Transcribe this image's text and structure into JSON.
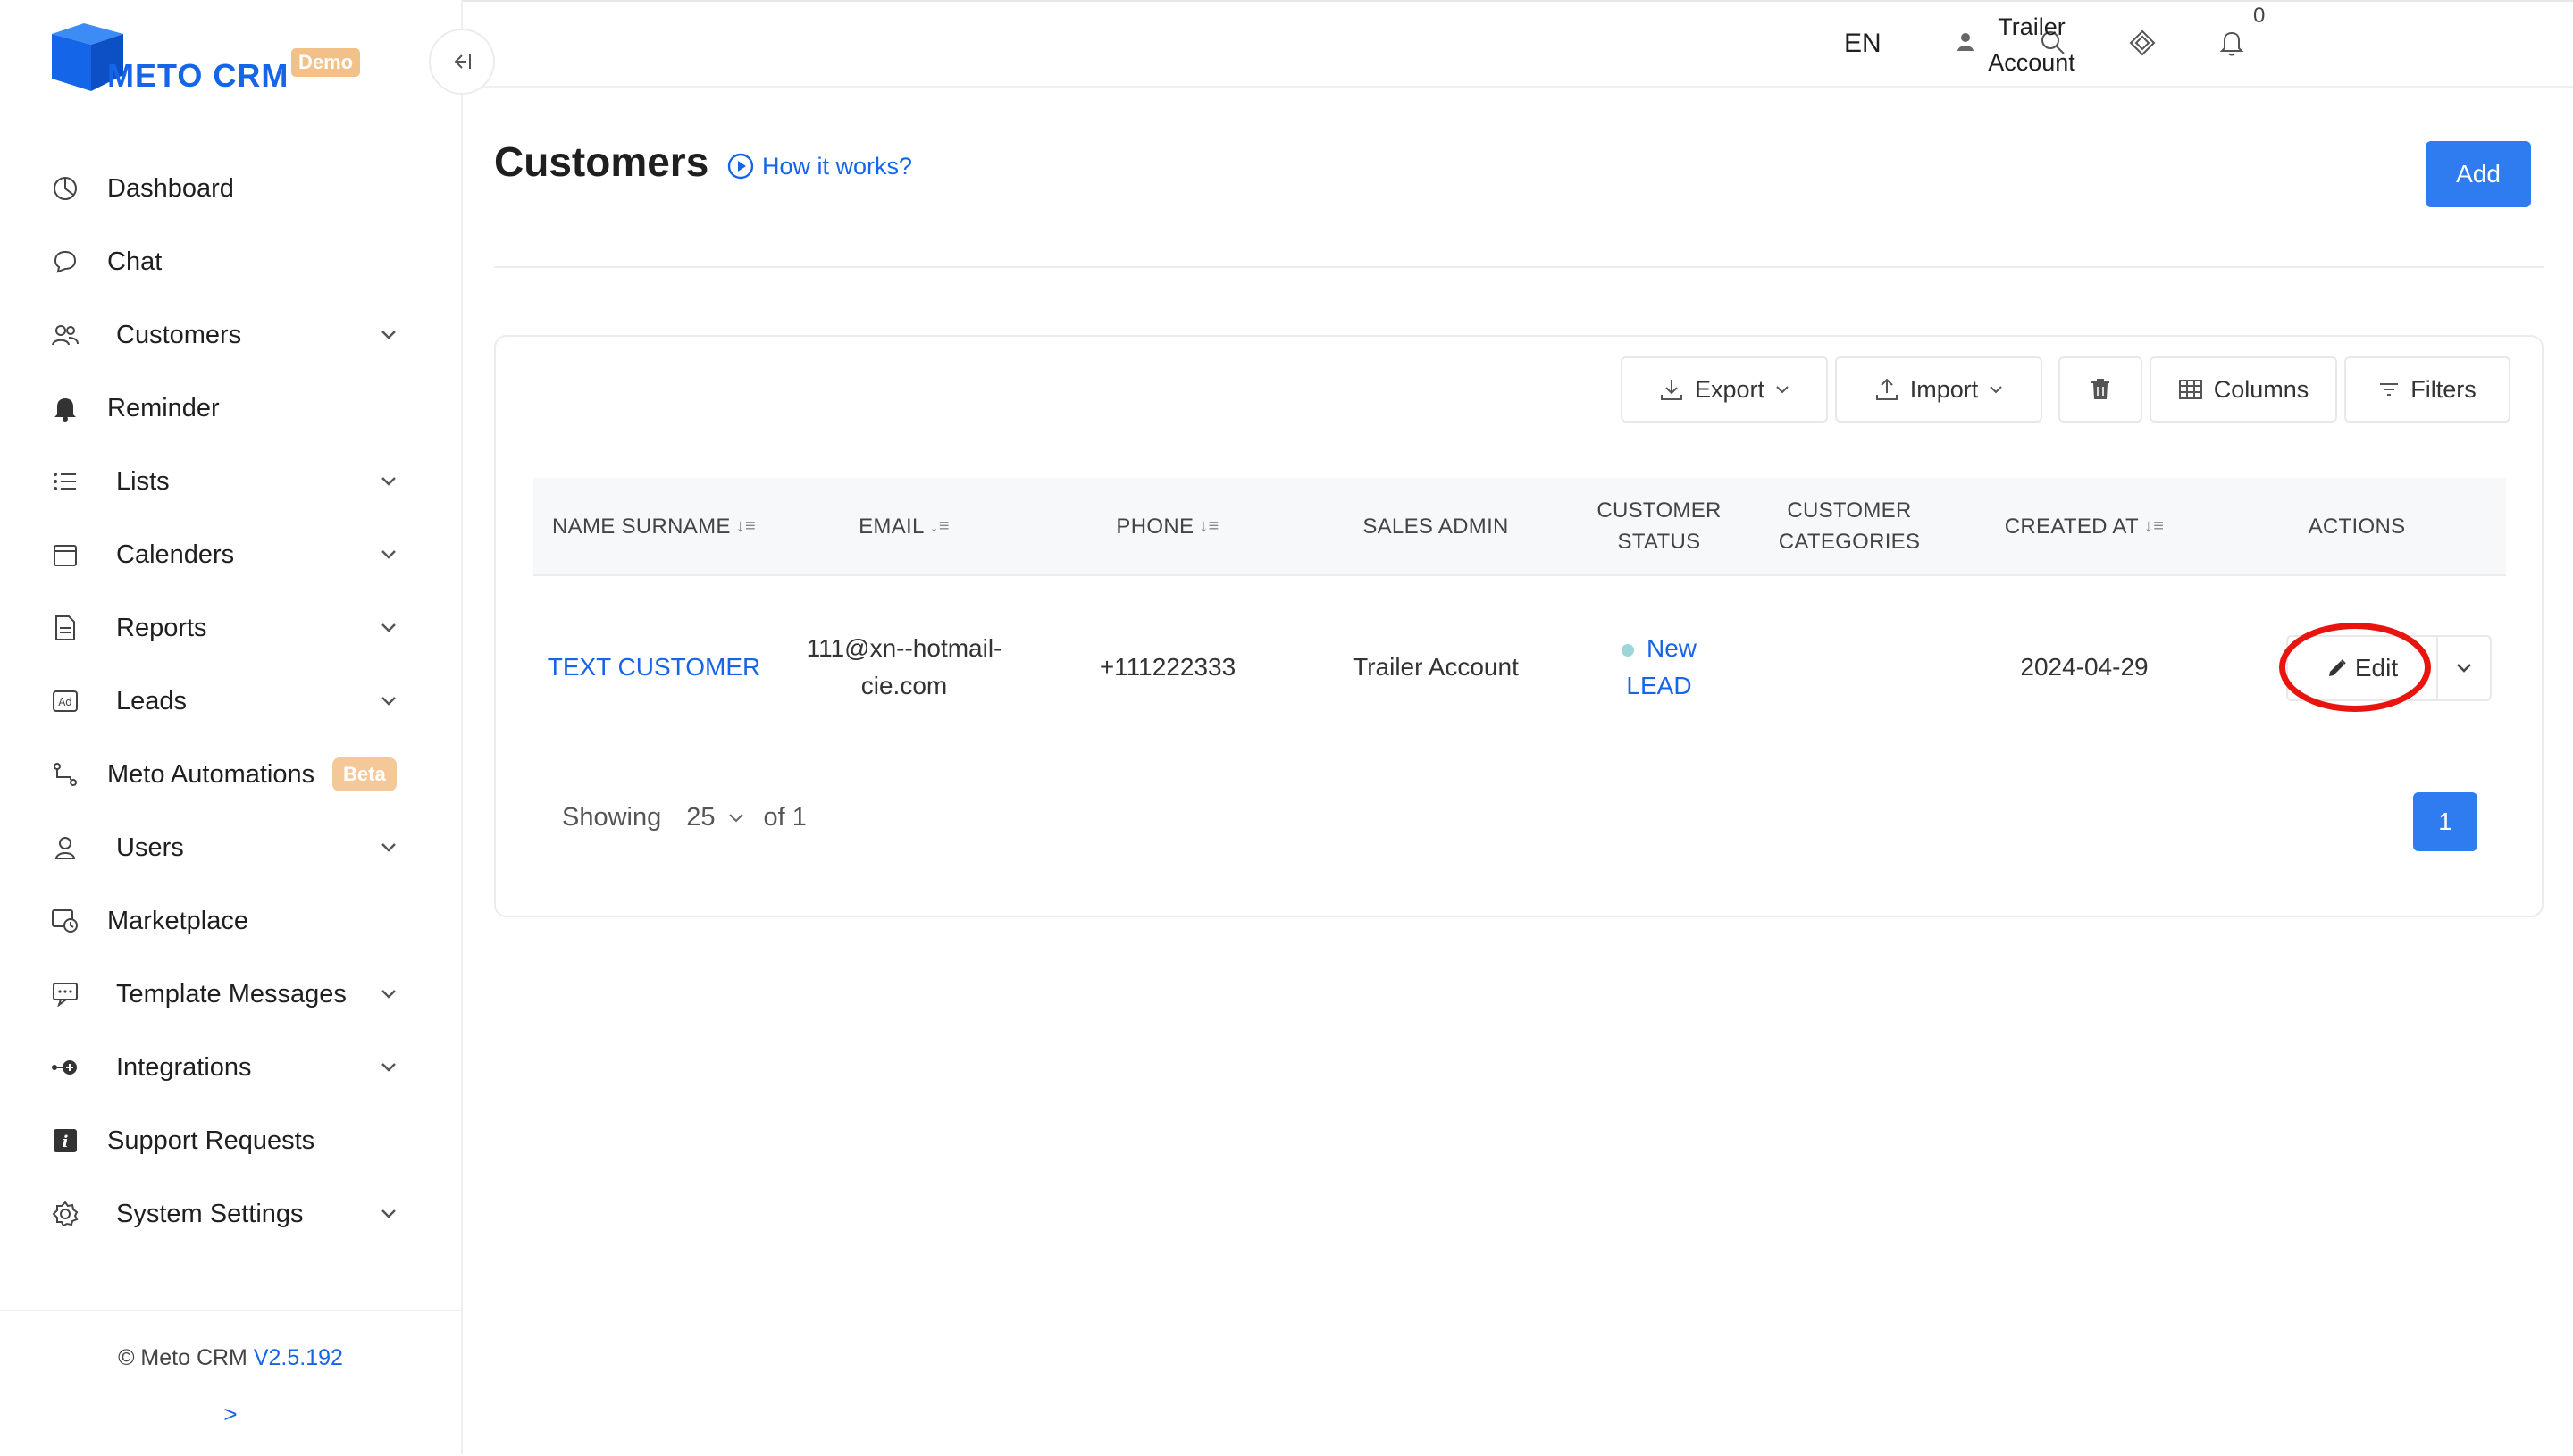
{
  "brand": {
    "name": "METO CRM",
    "badge": "Demo",
    "color": "#1565e8"
  },
  "sidebar": {
    "items": [
      {
        "label": "Dashboard",
        "icon": "dashboard-icon",
        "chevron": false
      },
      {
        "label": "Chat",
        "icon": "chat-icon",
        "chevron": false
      },
      {
        "label": "Customers",
        "icon": "customers-icon",
        "chevron": true
      },
      {
        "label": "Reminder",
        "icon": "bell-icon",
        "chevron": false
      },
      {
        "label": "Lists",
        "icon": "list-icon",
        "chevron": true
      },
      {
        "label": "Calenders",
        "icon": "calendar-icon",
        "chevron": true
      },
      {
        "label": "Reports",
        "icon": "report-icon",
        "chevron": true
      },
      {
        "label": "Leads",
        "icon": "ad-icon",
        "chevron": true
      },
      {
        "label": "Meto Automations",
        "icon": "automation-icon",
        "chevron": false,
        "badge": "Beta"
      },
      {
        "label": "Users",
        "icon": "user-icon",
        "chevron": true
      },
      {
        "label": "Marketplace",
        "icon": "marketplace-icon",
        "chevron": false
      },
      {
        "label": "Template Messages",
        "icon": "template-icon",
        "chevron": true
      },
      {
        "label": "Integrations",
        "icon": "integration-icon",
        "chevron": true
      },
      {
        "label": "Support Requests",
        "icon": "info-icon",
        "chevron": false
      },
      {
        "label": "System Settings",
        "icon": "gear-icon",
        "chevron": true
      }
    ],
    "footer": {
      "copyright": "© Meto CRM",
      "version": "V2.5.192",
      "expand": ">"
    }
  },
  "header": {
    "notification_count": "0",
    "language": "EN",
    "user_line1": "Trailer",
    "user_line2": "Account"
  },
  "page": {
    "title": "Customers",
    "how_it_works": "How it works?",
    "add_label": "Add"
  },
  "toolbar": {
    "export_label": "Export",
    "import_label": "Import",
    "columns_label": "Columns",
    "filters_label": "Filters"
  },
  "table": {
    "headers": {
      "name": "NAME SURNAME",
      "email": "EMAIL",
      "phone": "PHONE",
      "sales_admin": "SALES ADMIN",
      "status_l1": "CUSTOMER",
      "status_l2": "STATUS",
      "categories_l1": "CUSTOMER",
      "categories_l2": "CATEGORIES",
      "created_at": "CREATED AT",
      "actions": "ACTIONS"
    },
    "rows": [
      {
        "name": "TEXT CUSTOMER",
        "email_l1": "111@xn--hotmail-",
        "email_l2": "cie.com",
        "phone": "+111222333",
        "sales_admin": "Trailer Account",
        "status_l1": "New",
        "status_l2": "LEAD",
        "categories": "",
        "created_at": "2024-04-29",
        "edit_label": "Edit"
      }
    ]
  },
  "pagination": {
    "showing_label": "Showing",
    "page_size": "25",
    "of_label": "of 1",
    "current_page": "1"
  },
  "colors": {
    "primary": "#2f7bf0",
    "highlight": "#e8140f",
    "status_dot": "#9dd6d9"
  }
}
